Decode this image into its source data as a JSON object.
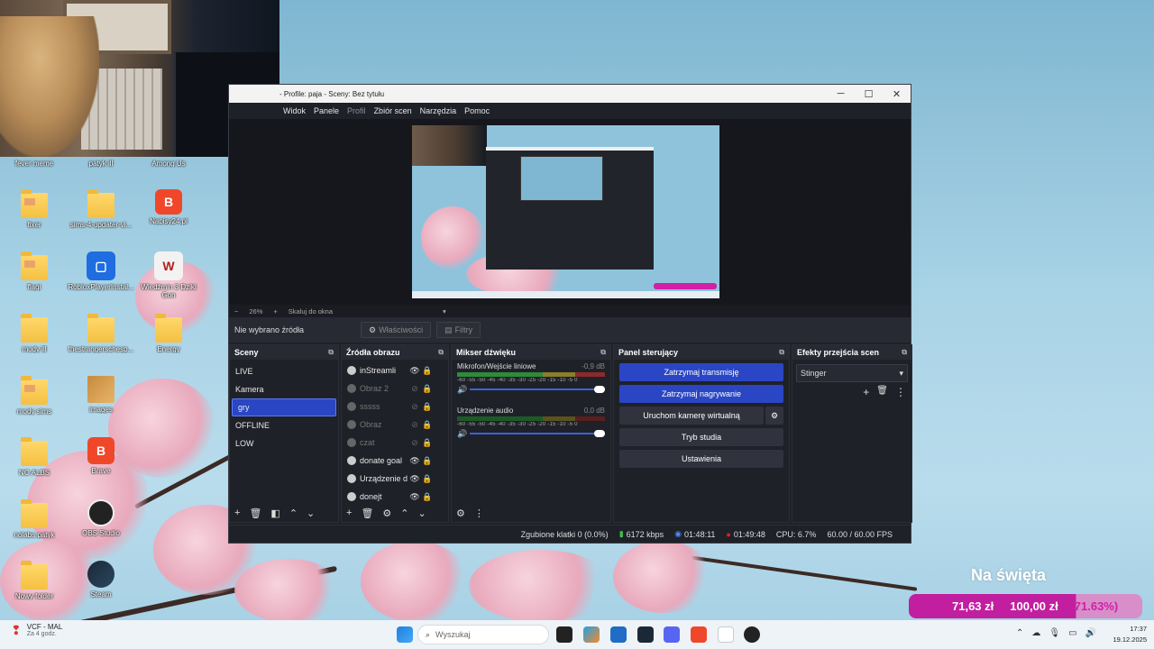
{
  "desktop": {
    "top_row_labels": [
      "fever meme",
      "patyk ill",
      "Among Us"
    ],
    "icons": [
      {
        "label": "fixer",
        "kind": "photo-folder"
      },
      {
        "label": "sims-4-updater-vi...",
        "kind": "folder"
      },
      {
        "label": "Napisy24.pl",
        "kind": "brave"
      },
      {
        "label": "flagi",
        "kind": "photo-folder"
      },
      {
        "label": "RobloxPlayerInstal...",
        "kind": "roblox"
      },
      {
        "label": "Wiedźmin 3 Dziki Gon",
        "kind": "witcher"
      },
      {
        "label": "mody ill",
        "kind": "folder"
      },
      {
        "label": "thestrangerschesp...",
        "kind": "folder"
      },
      {
        "label": "Energy",
        "kind": "folder"
      },
      {
        "label": "mody sims",
        "kind": "photo-folder"
      },
      {
        "label": "images",
        "kind": "image"
      },
      {
        "label": "NO ALBS",
        "kind": "folder"
      },
      {
        "label": "Brave",
        "kind": "brave"
      },
      {
        "label": "nolabs patyk",
        "kind": "folder"
      },
      {
        "label": "OBS Studio",
        "kind": "obs"
      },
      {
        "label": "Nowy folder",
        "kind": "folder"
      },
      {
        "label": "Steam",
        "kind": "steam"
      }
    ]
  },
  "obs": {
    "title": "- Profile: paja - Sceny: Bez tytułu",
    "menu": [
      "Widok",
      "Panele",
      "Profil",
      "Zbiór scen",
      "Narzędzia",
      "Pomoc"
    ],
    "zoom": "26%",
    "scale_label": "Skaluj do okna",
    "no_source": "Nie wybrano źródła",
    "properties": "Właściwości",
    "filters": "Filtry",
    "docks": {
      "scenes_title": "Sceny",
      "scenes": [
        "LIVE",
        "Kamera",
        "gry",
        "OFFLINE",
        "LOW"
      ],
      "selected_scene": "gry",
      "sources_title": "Źródła obrazu",
      "sources": [
        {
          "name": "inStreamli",
          "visible": true
        },
        {
          "name": "Obraz 2",
          "visible": false
        },
        {
          "name": "sssss",
          "visible": false
        },
        {
          "name": "Obraz",
          "visible": false
        },
        {
          "name": "czat",
          "visible": false
        },
        {
          "name": "donate goal",
          "visible": true
        },
        {
          "name": "Urządzenie d",
          "visible": true
        },
        {
          "name": "donejt",
          "visible": true
        }
      ],
      "mixer_title": "Mikser dźwięku",
      "mixer": [
        {
          "name": "Mikrofon/Wejście liniowe",
          "db": "-0,9 dB"
        },
        {
          "name": "Urządzenie audio",
          "db": "0,0 dB"
        }
      ],
      "meter_ticks": "-60 -55 -50 -45 -40 -35 -30 -25 -20 -15 -10 -5 0",
      "controls_title": "Panel sterujący",
      "controls": [
        "Zatrzymaj transmisję",
        "Zatrzymaj nagrywanie",
        "Uruchom kamerę wirtualną",
        "Tryb studia",
        "Ustawienia"
      ],
      "transitions_title": "Efekty przejścia scen",
      "transition": "Stinger"
    },
    "status": {
      "dropped": "Zgubione klatki 0 (0.0%)",
      "bitrate": "6172 kbps",
      "stream_time": "01:48:11",
      "rec_time": "01:49:48",
      "cpu": "CPU: 6.7%",
      "fps": "60.00 / 60.00 FPS"
    }
  },
  "overlay": {
    "title": "Na święta",
    "current": "71,63 zł",
    "target": "100,00 zł",
    "percent": "71.63%)",
    "progress_fraction": 0.716
  },
  "taskbar": {
    "news_title": "VCF - MAL",
    "news_sub": "Za 4 godz.",
    "search_placeholder": "Wyszukaj",
    "time": "17:37",
    "date": "19.12.2025"
  }
}
